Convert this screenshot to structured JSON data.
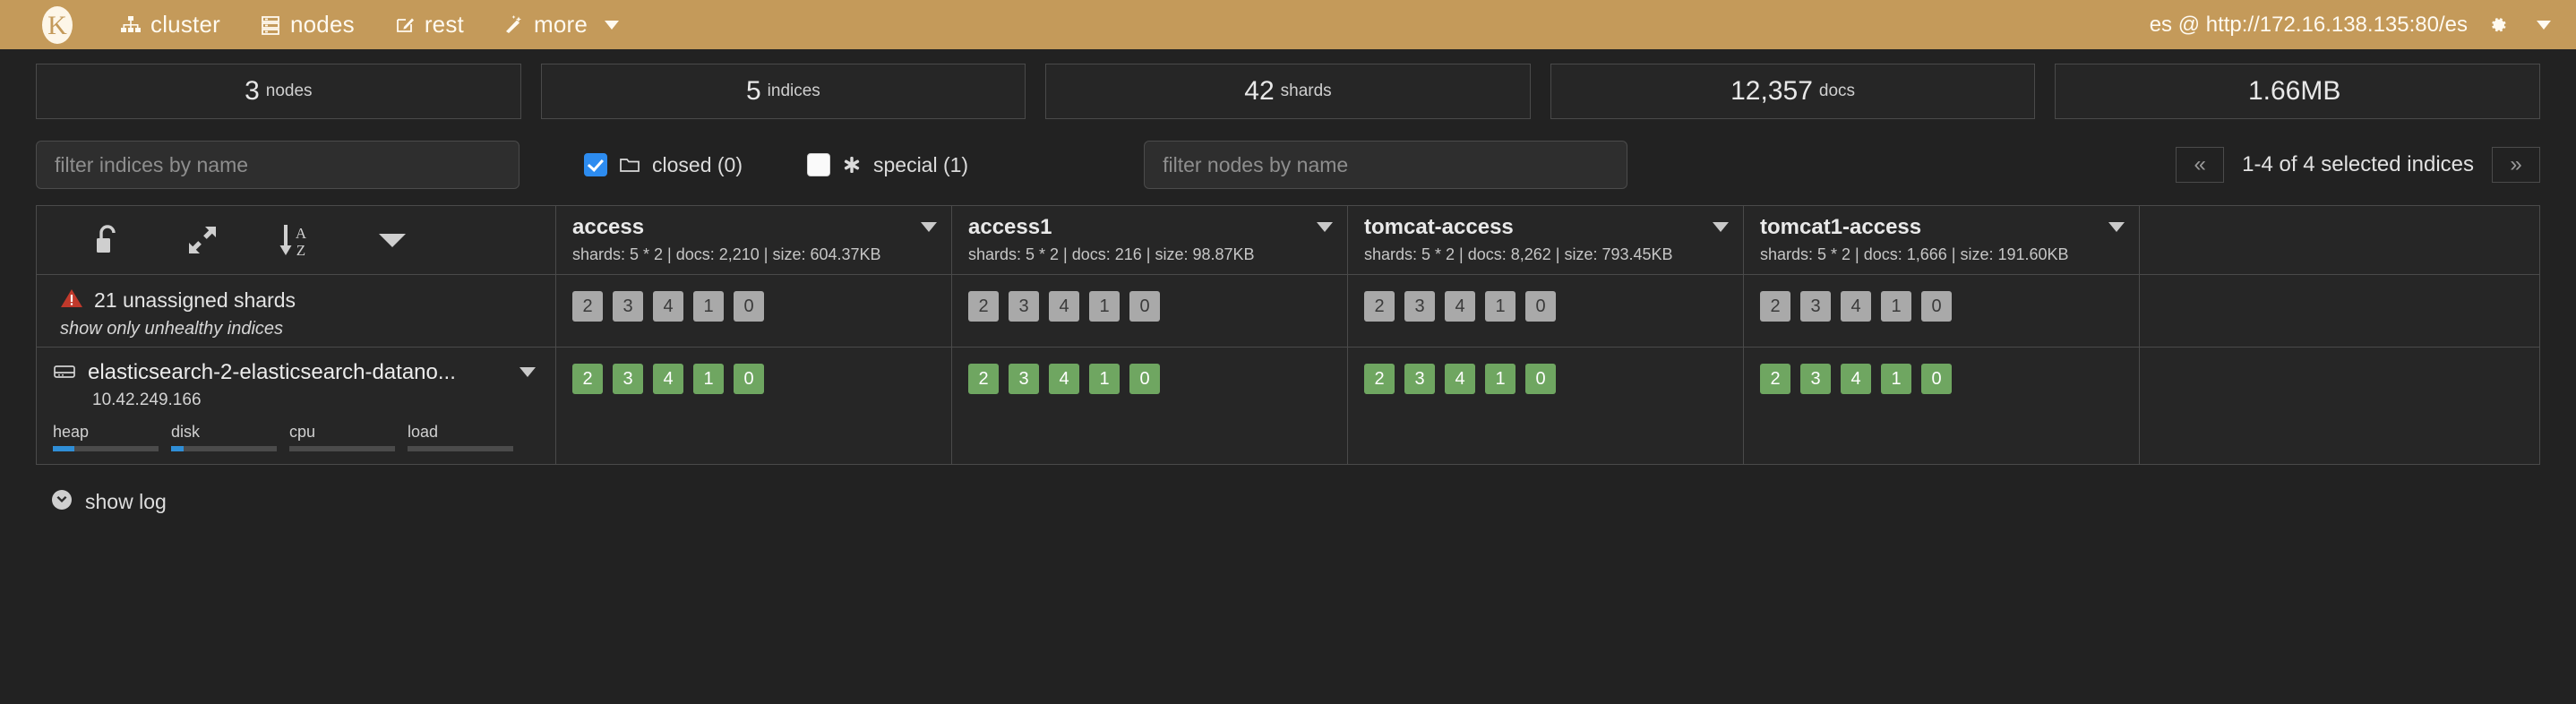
{
  "navbar": {
    "brand_icon": "kopf-logo-icon",
    "items": [
      {
        "label": "cluster",
        "icon": "cluster-icon"
      },
      {
        "label": "nodes",
        "icon": "nodes-icon"
      },
      {
        "label": "rest",
        "icon": "rest-pencil-icon"
      },
      {
        "label": "more",
        "icon": "magic-wand-icon",
        "has_caret": true
      }
    ],
    "connection": "es @ http://172.16.138.135:80/es",
    "settings_icon": "gear-icon",
    "settings_caret_icon": "chevron-down-icon",
    "bg_color": "#c49a5a"
  },
  "stats": [
    {
      "value": "3",
      "unit": "nodes"
    },
    {
      "value": "5",
      "unit": "indices"
    },
    {
      "value": "42",
      "unit": "shards"
    },
    {
      "value": "12,357",
      "unit": "docs"
    },
    {
      "value": "1.66MB",
      "unit": ""
    }
  ],
  "filters": {
    "indices_filter_placeholder": "filter indices by name",
    "indices_filter_value": "",
    "nodes_filter_placeholder": "filter nodes by name",
    "nodes_filter_value": "",
    "closed": {
      "label": "closed (0)",
      "checked": true,
      "icon": "folder-icon"
    },
    "special": {
      "label": "special (1)",
      "checked": false,
      "icon": "asterisk-icon"
    }
  },
  "pager": {
    "prev_label": "«",
    "next_label": "»",
    "status": "1-4 of 4 selected indices"
  },
  "toolbar": {
    "lock_icon": "unlock-icon",
    "expand_icon": "expand-arrows-icon",
    "sort_icon": "sort-a-z-icon",
    "menu_icon": "caret-down-icon"
  },
  "indices": [
    {
      "name": "access",
      "meta": "shards: 5 * 2 | docs: 2,210 | size: 604.37KB"
    },
    {
      "name": "access1",
      "meta": "shards: 5 * 2 | docs: 216 | size: 98.87KB"
    },
    {
      "name": "tomcat-access",
      "meta": "shards: 5 * 2 | docs: 8,262 | size: 793.45KB"
    },
    {
      "name": "tomcat1-access",
      "meta": "shards: 5 * 2 | docs: 1,666 | size: 191.60KB"
    }
  ],
  "unassigned": {
    "warning_icon": "warning-triangle-icon",
    "title": "21 unassigned shards",
    "subtitle": "show only unhealthy indices",
    "shards": [
      [
        "2",
        "3",
        "4",
        "1",
        "0"
      ],
      [
        "2",
        "3",
        "4",
        "1",
        "0"
      ],
      [
        "2",
        "3",
        "4",
        "1",
        "0"
      ],
      [
        "2",
        "3",
        "4",
        "1",
        "0"
      ]
    ],
    "badge_color": "#a9a9a9"
  },
  "node": {
    "icon": "server-node-icon",
    "name": "elasticsearch-2-elasticsearch-datano...",
    "ip": "10.42.249.166",
    "caret_icon": "chevron-down-icon",
    "metrics": [
      {
        "label": "heap",
        "percent": 20
      },
      {
        "label": "disk",
        "percent": 12
      },
      {
        "label": "cpu",
        "percent": 0
      },
      {
        "label": "load",
        "percent": 0
      }
    ],
    "shards": [
      [
        "2",
        "3",
        "4",
        "1",
        "0"
      ],
      [
        "2",
        "3",
        "4",
        "1",
        "0"
      ],
      [
        "2",
        "3",
        "4",
        "1",
        "0"
      ],
      [
        "2",
        "3",
        "4",
        "1",
        "0"
      ]
    ],
    "badge_color": "#6fa661"
  },
  "footer": {
    "show_log_label": "show log",
    "show_log_icon": "chevron-down-circle-icon"
  }
}
